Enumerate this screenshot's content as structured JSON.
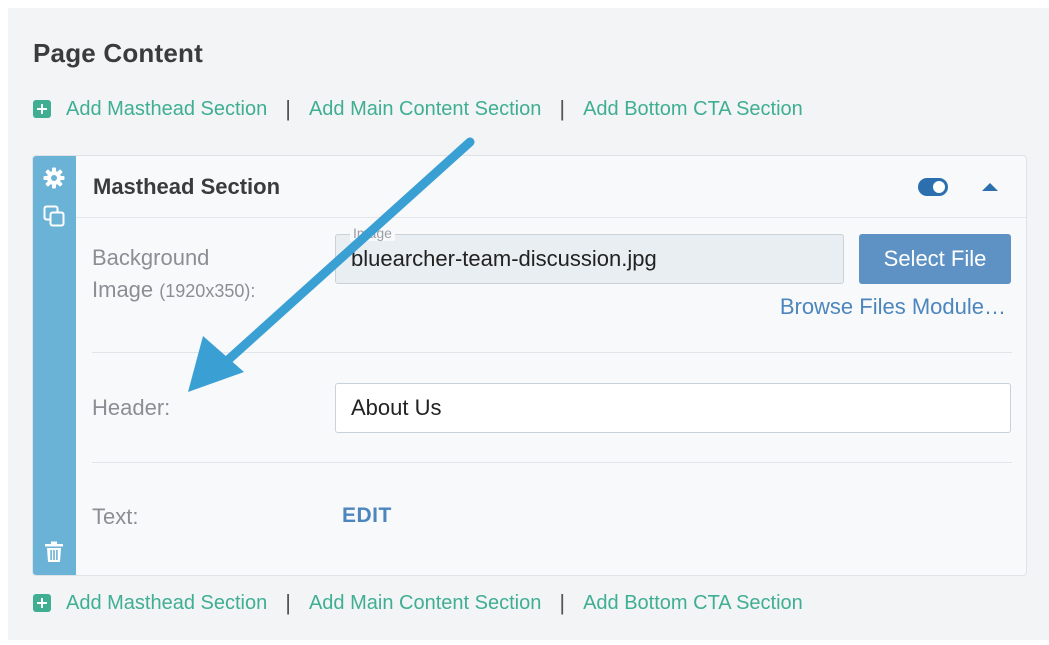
{
  "page": {
    "title": "Page Content"
  },
  "add_links": {
    "masthead": "Add Masthead Section",
    "main": "Add Main Content Section",
    "cta": "Add Bottom CTA Section",
    "separator": "|"
  },
  "section": {
    "title": "Masthead Section",
    "toggle_on": true,
    "background": {
      "label": "Background",
      "label_line2": "Image",
      "size_hint": "(1920x350):",
      "field_legend": "Image",
      "file_value": "bluearcher-team-discussion.jpg",
      "select_label": "Select File",
      "browse_label": "Browse Files Module…"
    },
    "header": {
      "label": "Header:",
      "value": "About Us"
    },
    "text": {
      "label": "Text:",
      "edit_label": "EDIT"
    }
  },
  "colors": {
    "accent_green": "#3fae93",
    "sidebar_blue": "#6ab2d6",
    "link_blue": "#4d86bc",
    "button_blue": "#5e92c4",
    "arrow_blue": "#3aa0d3"
  },
  "icons": {
    "sidebar": [
      "gear-icon",
      "copy-icon",
      "trash-icon"
    ],
    "header": [
      "toggle-switch",
      "chevron-up-icon"
    ],
    "add": "plus-square-icon",
    "annotation": "arrow-annotation"
  }
}
